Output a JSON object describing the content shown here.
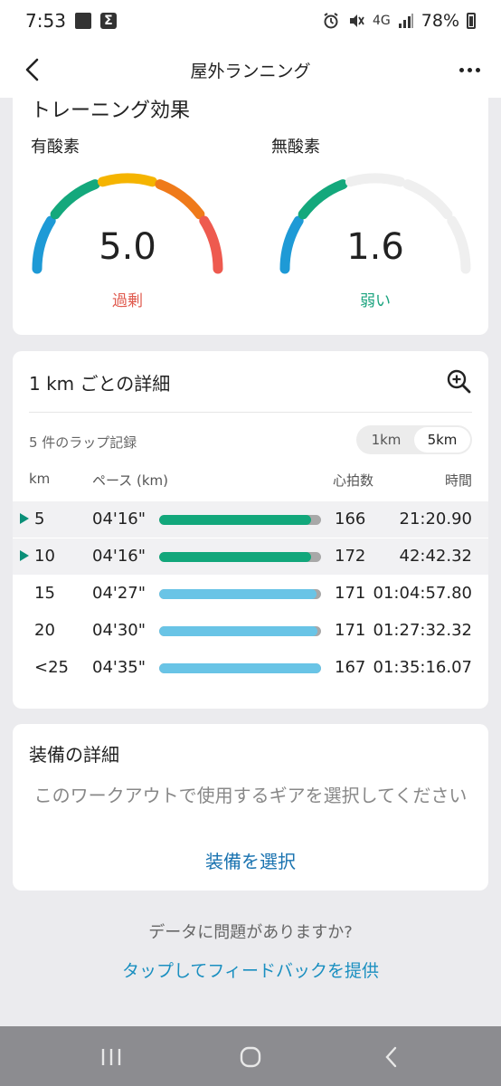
{
  "status_bar": {
    "time": "7:53",
    "network": "4G",
    "battery": "78%"
  },
  "header": {
    "title": "屋外ランニング"
  },
  "training": {
    "title": "トレーニング効果",
    "aerobic": {
      "label": "有酸素",
      "value": "5.0",
      "status": "過剰",
      "status_color": "#e05a4e",
      "level": 5.0
    },
    "anaerobic": {
      "label": "無酸素",
      "value": "1.6",
      "status": "弱い",
      "status_color": "#1aa37e",
      "level": 1.6
    },
    "colors": {
      "blue": "#1e9ad6",
      "green": "#14a87c",
      "yellow": "#f5b400",
      "orange": "#ef7a1a",
      "red": "#ee5a4f",
      "empty": "#efefef"
    }
  },
  "laps": {
    "title": "1 km ごとの詳細",
    "count": "5 件のラップ記録",
    "segments": [
      "1km",
      "5km"
    ],
    "active_segment": "5km",
    "columns": {
      "km": "km",
      "pace": "ペース (km)",
      "hr": "心拍数",
      "time": "時間"
    },
    "rows": [
      {
        "km": "5",
        "pace": "04'16\"",
        "hr": "166",
        "time": "21:20.90",
        "highlight": true,
        "fill": 0.94,
        "color": "#12a77b"
      },
      {
        "km": "10",
        "pace": "04'16\"",
        "hr": "172",
        "time": "42:42.32",
        "highlight": true,
        "fill": 0.94,
        "color": "#12a77b"
      },
      {
        "km": "15",
        "pace": "04'27\"",
        "hr": "171",
        "time": "01:04:57.80",
        "highlight": false,
        "fill": 0.97,
        "color": "#69c4e6"
      },
      {
        "km": "20",
        "pace": "04'30\"",
        "hr": "171",
        "time": "01:27:32.32",
        "highlight": false,
        "fill": 0.98,
        "color": "#69c4e6"
      },
      {
        "km": "<25",
        "pace": "04'35\"",
        "hr": "167",
        "time": "01:35:16.07",
        "highlight": false,
        "fill": 1.0,
        "color": "#69c4e6"
      }
    ]
  },
  "gear": {
    "title": "装備の詳細",
    "message": "このワークアウトで使用するギアを選択してください",
    "link": "装備を選択"
  },
  "feedback": {
    "question": "データに問題がありますか?",
    "link": "タップしてフィードバックを提供"
  }
}
